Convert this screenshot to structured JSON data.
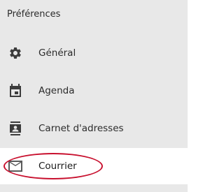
{
  "preferences": {
    "title": "Préférences",
    "items": [
      {
        "label": "Général",
        "icon": "gear-icon"
      },
      {
        "label": "Agenda",
        "icon": "calendar-icon"
      },
      {
        "label": "Carnet d'adresses",
        "icon": "address-book-icon"
      },
      {
        "label": "Courrier",
        "icon": "mail-icon",
        "active": true
      }
    ]
  },
  "colors": {
    "panel_bg": "#e8e8e8",
    "active_bg": "#ffffff",
    "icon": "#3c3c3c",
    "highlight": "#c8102e"
  }
}
